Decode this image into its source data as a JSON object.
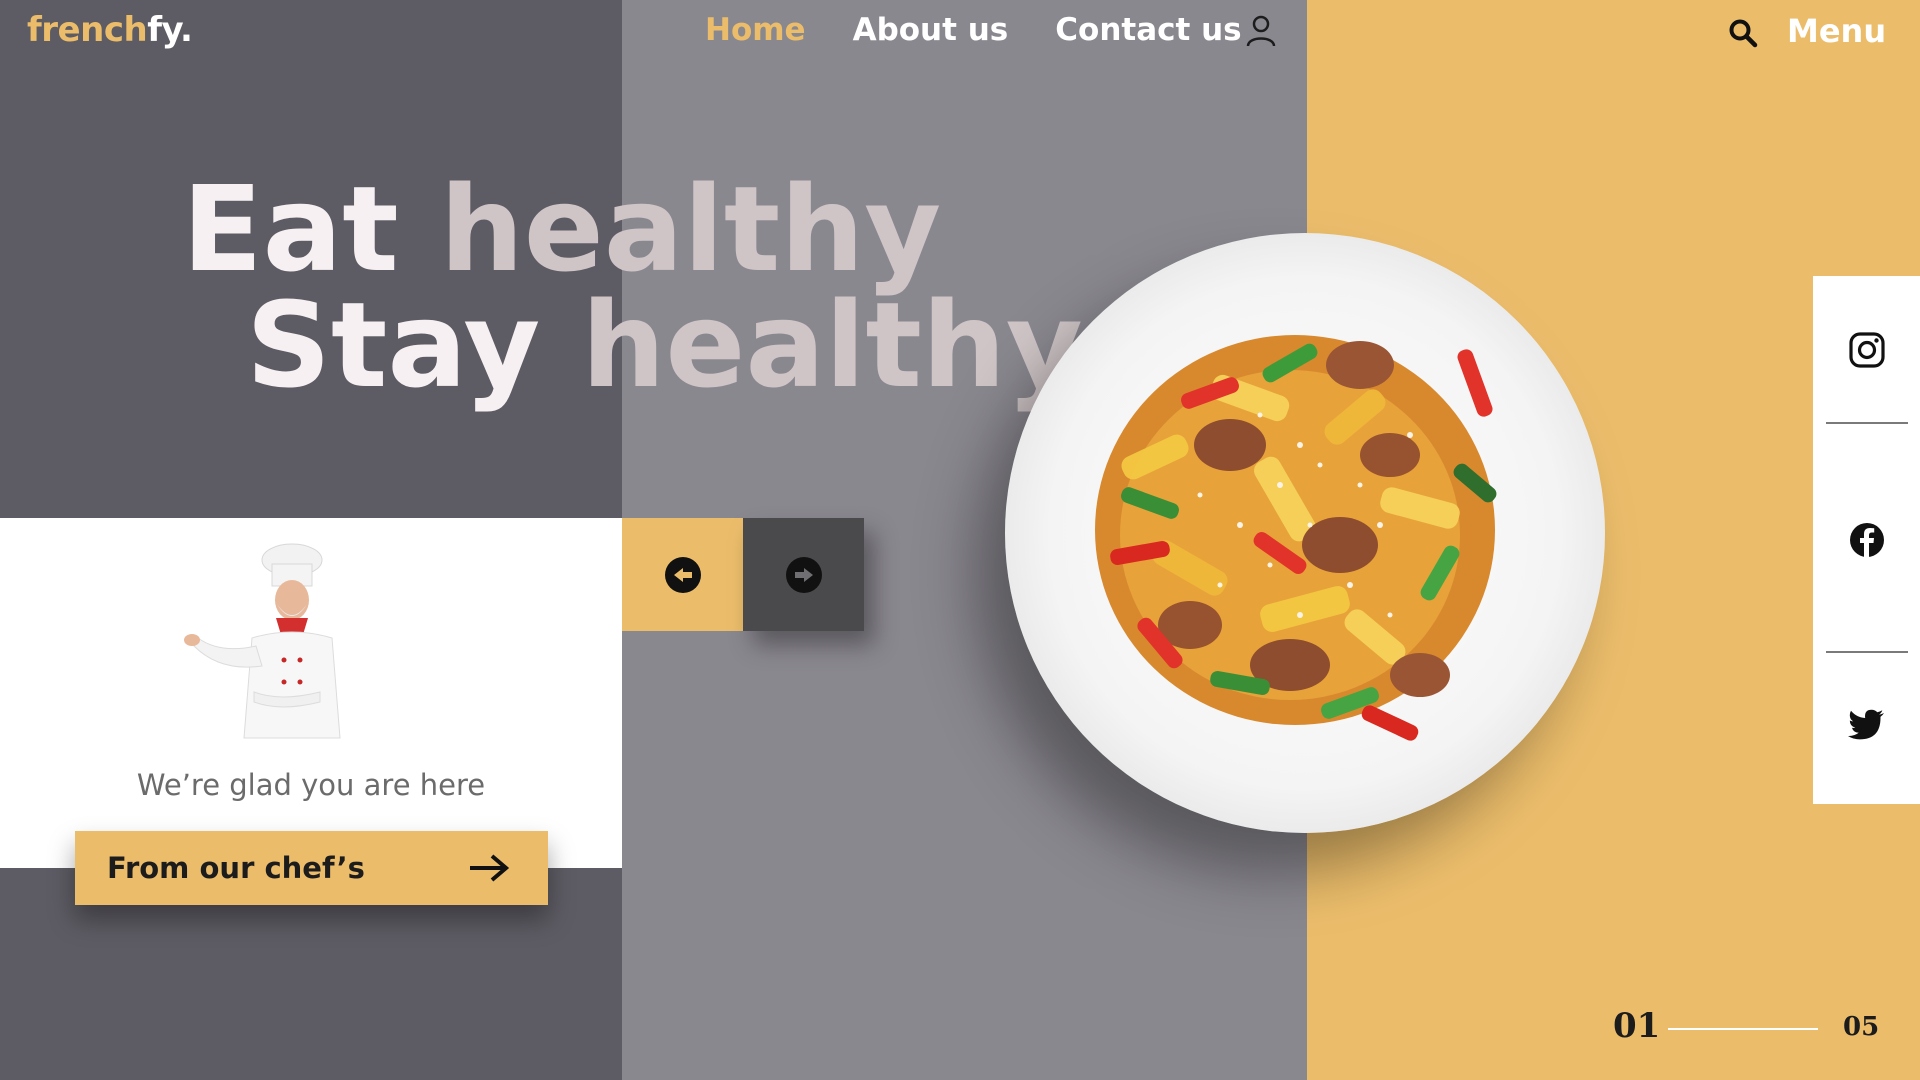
{
  "brand": {
    "part1": "french",
    "part2": "fy."
  },
  "nav": {
    "items": [
      "Home",
      "About us",
      "Contact us"
    ],
    "active_index": 0
  },
  "header": {
    "menu_label": "Menu"
  },
  "hero": {
    "line1": {
      "strong": "Eat ",
      "light": "healthy"
    },
    "line2": {
      "strong": "Stay ",
      "light": "healthy"
    }
  },
  "chef_card": {
    "greeting": "We’re glad you are here",
    "cta_label": "From our chef’s"
  },
  "pagination": {
    "current": "01",
    "total": "05"
  },
  "colors": {
    "accent": "#ebbd6b",
    "dark": "#5d5b63",
    "mid": "#8a888f",
    "control_dark": "#4a4a4d"
  },
  "icons": [
    "user-icon",
    "search-icon",
    "arrow-left-icon",
    "arrow-right-icon",
    "instagram-icon",
    "facebook-icon",
    "twitter-icon"
  ]
}
